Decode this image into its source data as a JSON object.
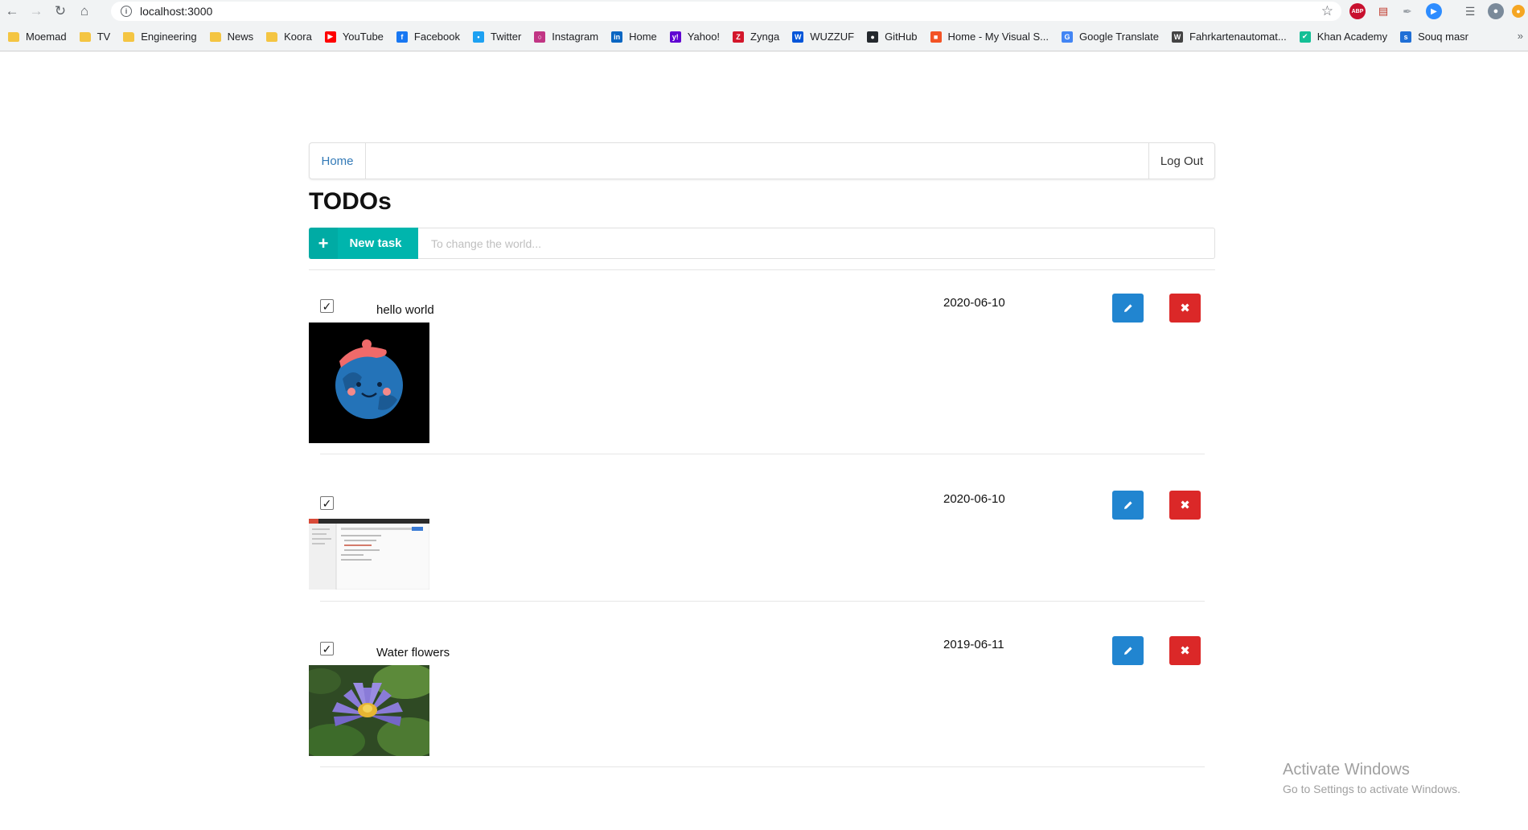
{
  "browser": {
    "url": "localhost:3000",
    "bookmarks": [
      {
        "label": "Moemad",
        "icon": "folder-icon",
        "color": "#f4c542"
      },
      {
        "label": "TV",
        "icon": "folder-icon",
        "color": "#f4c542"
      },
      {
        "label": "Engineering",
        "icon": "folder-icon",
        "color": "#f4c542"
      },
      {
        "label": "News",
        "icon": "folder-icon",
        "color": "#f4c542"
      },
      {
        "label": "Koora",
        "icon": "folder-icon",
        "color": "#f4c542"
      },
      {
        "label": "YouTube",
        "icon": "youtube-icon",
        "color": "#ff0000"
      },
      {
        "label": "Facebook",
        "icon": "facebook-icon",
        "color": "#1877f2"
      },
      {
        "label": "Twitter",
        "icon": "twitter-icon",
        "color": "#1da1f2"
      },
      {
        "label": "Instagram",
        "icon": "instagram-icon",
        "color": "#c13584"
      },
      {
        "label": "Home",
        "icon": "linkedin-icon",
        "color": "#0a66c2"
      },
      {
        "label": "Yahoo!",
        "icon": "yahoo-icon",
        "color": "#6001d2"
      },
      {
        "label": "Zynga",
        "icon": "zynga-icon",
        "color": "#d3172b"
      },
      {
        "label": "WUZZUF",
        "icon": "wuzzuf-icon",
        "color": "#0055d9"
      },
      {
        "label": "GitHub",
        "icon": "github-icon",
        "color": "#24292e"
      },
      {
        "label": "Home - My Visual S...",
        "icon": "microsoft-icon",
        "color": "#f35325"
      },
      {
        "label": "Google Translate",
        "icon": "google-translate-icon",
        "color": "#4285f4"
      },
      {
        "label": "Fahrkartenautomat...",
        "icon": "wikipedia-icon",
        "color": "#444444"
      },
      {
        "label": "Khan Academy",
        "icon": "khan-academy-icon",
        "color": "#14bf96"
      },
      {
        "label": "Souq masr",
        "icon": "souq-icon",
        "color": "#1f6fd6"
      }
    ]
  },
  "nav": {
    "home": "Home",
    "logout": "Log Out"
  },
  "page": {
    "title": "TODOs"
  },
  "new_task": {
    "label": "New task",
    "placeholder": "To change the world...",
    "accent": "#00b5ad"
  },
  "todos": [
    {
      "text": "hello world",
      "date": "2020-06-10",
      "checked": true,
      "image": "earth-cartoon"
    },
    {
      "text": "",
      "date": "2020-06-10",
      "checked": true,
      "image": "screenshot"
    },
    {
      "text": "Water flowers",
      "date": "2019-06-11",
      "checked": true,
      "image": "water-lily"
    }
  ],
  "colors": {
    "edit": "#2185d0",
    "delete": "#db2828",
    "link": "#337ab7"
  },
  "watermark": {
    "line1": "Activate Windows",
    "line2": "Go to Settings to activate Windows."
  }
}
